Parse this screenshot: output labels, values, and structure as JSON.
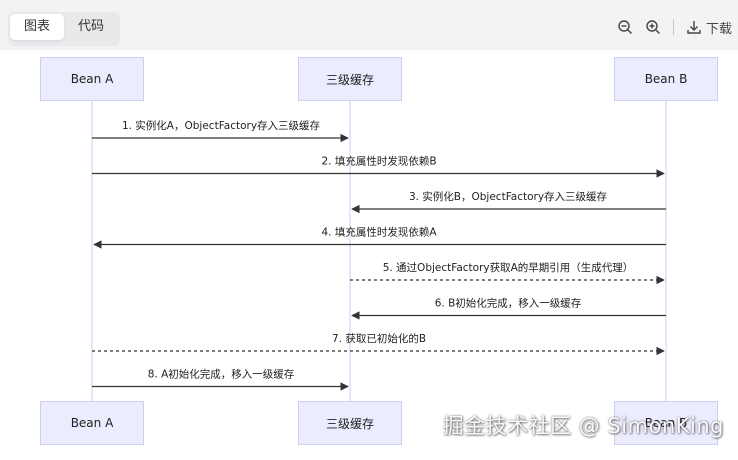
{
  "tabs": [
    {
      "label": "图表",
      "active": true
    },
    {
      "label": "代码",
      "active": false
    }
  ],
  "toolbar": {
    "zoom_out_icon": "zoom-out-icon",
    "zoom_in_icon": "zoom-in-icon",
    "download_icon": "download-icon",
    "download_label": "下载"
  },
  "diagram": {
    "participants": [
      "Bean A",
      "三级缓存",
      "Bean B"
    ],
    "messages": [
      {
        "from": 0,
        "to": 1,
        "label": "1. 实例化A，ObjectFactory存入三级缓存",
        "style": "solid"
      },
      {
        "from": 0,
        "to": 2,
        "label": "2. 填充属性时发现依赖B",
        "style": "solid"
      },
      {
        "from": 2,
        "to": 1,
        "label": "3. 实例化B，ObjectFactory存入三级缓存",
        "style": "solid"
      },
      {
        "from": 2,
        "to": 0,
        "label": "4. 填充属性时发现依赖A",
        "style": "solid"
      },
      {
        "from": 1,
        "to": 2,
        "label": "5. 通过ObjectFactory获取A的早期引用（生成代理）",
        "style": "dotted"
      },
      {
        "from": 2,
        "to": 1,
        "label": "6. B初始化完成，移入一级缓存",
        "style": "solid"
      },
      {
        "from": 0,
        "to": 2,
        "label": "7. 获取已初始化的B",
        "style": "dotted"
      },
      {
        "from": 0,
        "to": 1,
        "label": "8. A初始化完成，移入一级缓存",
        "style": "solid"
      }
    ]
  },
  "colors": {
    "actor_fill": "#ececff",
    "actor_border": "#cfcff0",
    "lifeline": "#d6d6f2",
    "arrow": "#333333"
  },
  "watermark": "掘金技术社区 @ SimonKing"
}
